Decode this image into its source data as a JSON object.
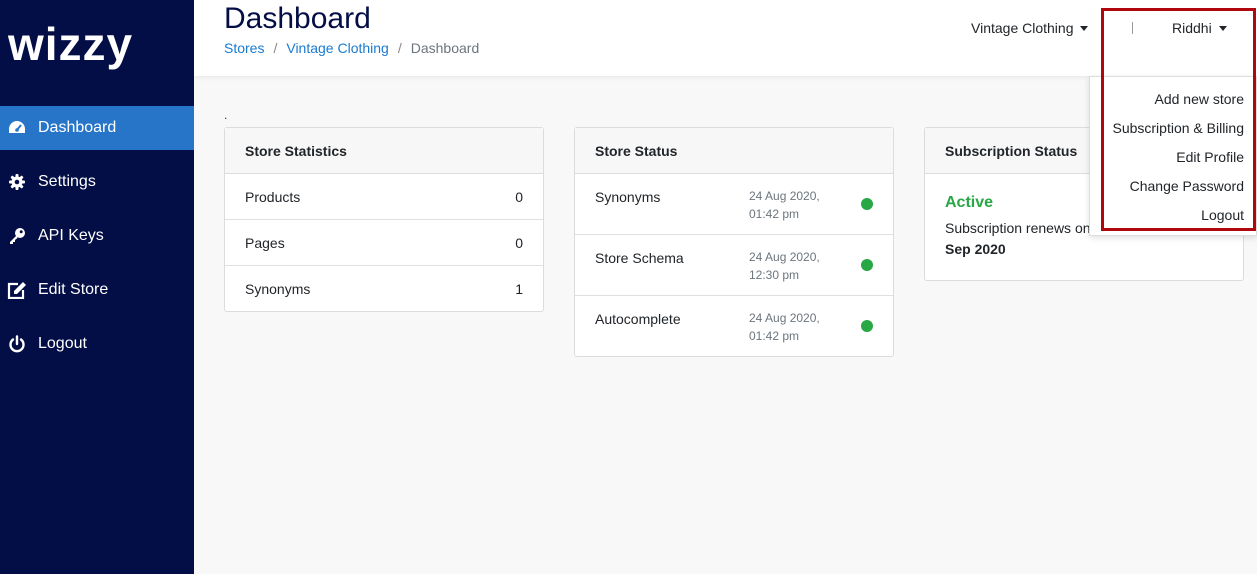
{
  "app": {
    "logo_text": "wizzy"
  },
  "sidebar": {
    "items": [
      {
        "label": "Dashboard",
        "icon": "speedometer-icon",
        "active": true
      },
      {
        "label": "Settings",
        "icon": "gear-icon",
        "active": false
      },
      {
        "label": "API Keys",
        "icon": "key-icon",
        "active": false
      },
      {
        "label": "Edit Store",
        "icon": "edit-icon",
        "active": false
      },
      {
        "label": "Logout",
        "icon": "power-icon",
        "active": false
      }
    ]
  },
  "header": {
    "title": "Dashboard",
    "breadcrumb": {
      "items": [
        "Stores",
        "Vintage Clothing",
        "Dashboard"
      ],
      "separator": "/"
    },
    "store_selector": "Vintage Clothing",
    "user_menu": "Riddhi"
  },
  "user_dropdown": {
    "items": [
      "Add new store",
      "Subscription & Billing",
      "Edit Profile",
      "Change Password",
      "Logout"
    ]
  },
  "main": {
    "marker": ".",
    "store_statistics": {
      "title": "Store Statistics",
      "rows": [
        {
          "label": "Products",
          "value": "0"
        },
        {
          "label": "Pages",
          "value": "0"
        },
        {
          "label": "Synonyms",
          "value": "1"
        }
      ]
    },
    "store_status": {
      "title": "Store Status",
      "rows": [
        {
          "label": "Synonyms",
          "date": "24 Aug 2020,",
          "time": "01:42 pm",
          "status": "ok"
        },
        {
          "label": "Store Schema",
          "date": "24 Aug 2020,",
          "time": "12:30 pm",
          "status": "ok"
        },
        {
          "label": "Autocomplete",
          "date": "24 Aug 2020,",
          "time": "01:42 pm",
          "status": "ok"
        }
      ]
    },
    "subscription_status": {
      "title": "Subscription Status",
      "status": "Active",
      "renews_text": "Subscription renews on",
      "renew_date": "Sep 2020"
    }
  },
  "colors": {
    "sidebar_bg": "#020e45",
    "active_nav": "#2675c8",
    "link": "#1a7bd1",
    "success": "#28a745",
    "highlight_border": "#b0070f"
  }
}
